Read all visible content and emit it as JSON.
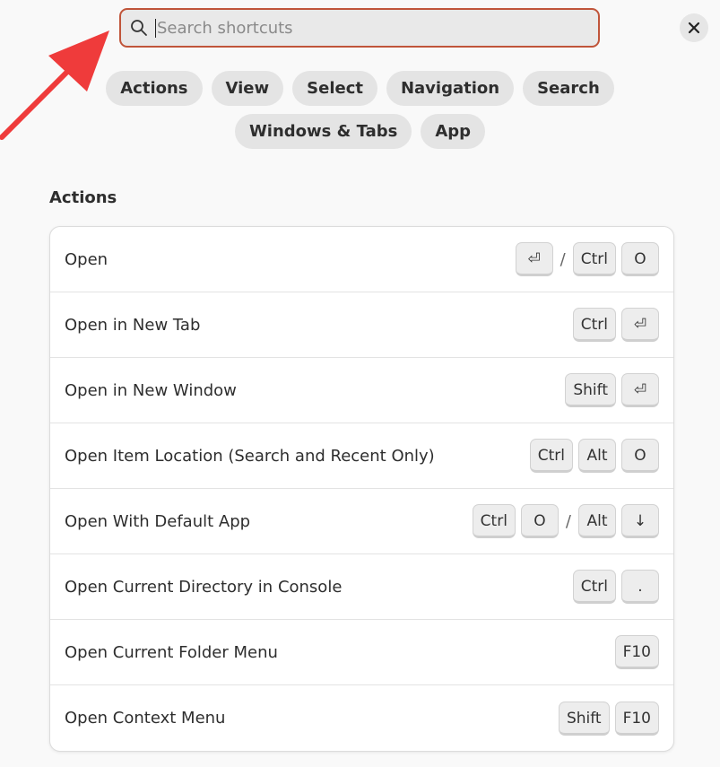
{
  "search": {
    "placeholder": "Search shortcuts",
    "value": ""
  },
  "close_icon": "close-icon",
  "categories_row1": [
    "Actions",
    "View",
    "Select",
    "Navigation",
    "Search"
  ],
  "categories_row2": [
    "Windows & Tabs",
    "App"
  ],
  "section": {
    "title": "Actions"
  },
  "shortcuts": [
    {
      "label": "Open",
      "keys": [
        "⏎",
        "/",
        "Ctrl",
        "O"
      ]
    },
    {
      "label": "Open in New Tab",
      "keys": [
        "Ctrl",
        "⏎"
      ]
    },
    {
      "label": "Open in New Window",
      "keys": [
        "Shift",
        "⏎"
      ]
    },
    {
      "label": "Open Item Location (Search and Recent Only)",
      "keys": [
        "Ctrl",
        "Alt",
        "O"
      ]
    },
    {
      "label": "Open With Default App",
      "keys": [
        "Ctrl",
        "O",
        "/",
        "Alt",
        "↓"
      ]
    },
    {
      "label": "Open Current Directory in Console",
      "keys": [
        "Ctrl",
        "."
      ]
    },
    {
      "label": "Open Current Folder Menu",
      "keys": [
        "F10"
      ]
    },
    {
      "label": "Open Context Menu",
      "keys": [
        "Shift",
        "F10"
      ]
    }
  ],
  "colors": {
    "search_border": "#c0553a",
    "arrow": "#ef3b3b",
    "pill_bg": "#e4e4e4"
  }
}
